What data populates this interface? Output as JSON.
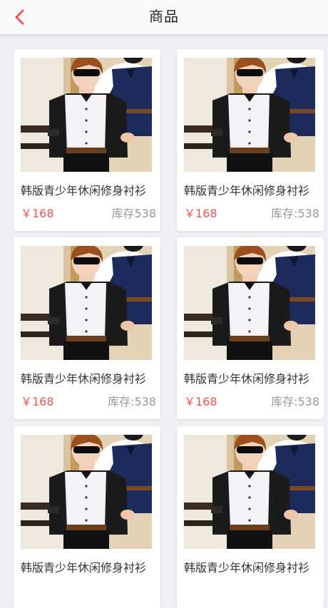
{
  "header": {
    "title": "商品",
    "back_icon": "chevron-left-icon",
    "accent_color": "#f0544e"
  },
  "products": [
    {
      "name": "韩版青少年休闲修身衬衫",
      "price": "￥168",
      "stock": "库存538",
      "image": "product-photo-shirt"
    },
    {
      "name": "韩版青少年休闲修身衬衫",
      "price": "￥168",
      "stock": "库存:538",
      "image": "product-photo-shirt"
    },
    {
      "name": "韩版青少年休闲修身衬衫",
      "price": "￥168",
      "stock": "库存:538",
      "image": "product-photo-shirt"
    },
    {
      "name": "韩版青少年休闲修身衬衫",
      "price": "￥168",
      "stock": "库存:538",
      "image": "product-photo-shirt"
    },
    {
      "name": "韩版青少年休闲修身衬衫",
      "price": "",
      "stock": "",
      "image": "product-photo-shirt"
    },
    {
      "name": "韩版青少年休闲修身衬衫",
      "price": "",
      "stock": "",
      "image": "product-photo-shirt"
    }
  ]
}
